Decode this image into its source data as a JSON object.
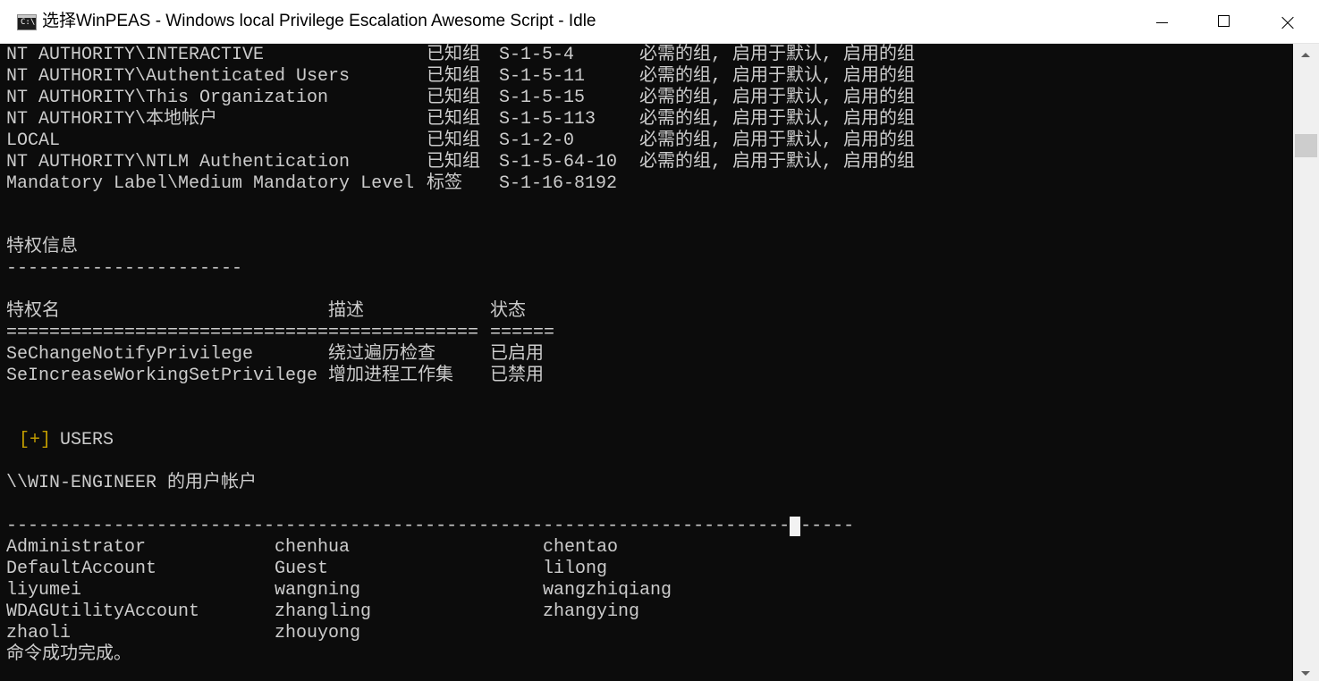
{
  "window": {
    "title": "选择WinPEAS - Windows local Privilege Escalation Awesome Script - Idle",
    "icon": "cmd-console-icon",
    "icon_text": "C:\\"
  },
  "groups": [
    {
      "name": "NT AUTHORITY\\INTERACTIVE",
      "type": "已知组",
      "sid": "S-1-5-4",
      "attributes": "必需的组, 启用于默认, 启用的组"
    },
    {
      "name": "NT AUTHORITY\\Authenticated Users",
      "type": "已知组",
      "sid": "S-1-5-11",
      "attributes": "必需的组, 启用于默认, 启用的组"
    },
    {
      "name": "NT AUTHORITY\\This Organization",
      "type": "已知组",
      "sid": "S-1-5-15",
      "attributes": "必需的组, 启用于默认, 启用的组"
    },
    {
      "name": "NT AUTHORITY\\本地帐户",
      "type": "已知组",
      "sid": "S-1-5-113",
      "attributes": "必需的组, 启用于默认, 启用的组"
    },
    {
      "name": "LOCAL",
      "type": "已知组",
      "sid": "S-1-2-0",
      "attributes": "必需的组, 启用于默认, 启用的组"
    },
    {
      "name": "NT AUTHORITY\\NTLM Authentication",
      "type": "已知组",
      "sid": "S-1-5-64-10",
      "attributes": "必需的组, 启用于默认, 启用的组"
    },
    {
      "name": "Mandatory Label\\Medium Mandatory Level",
      "type": "标签",
      "sid": "S-1-16-8192",
      "attributes": ""
    }
  ],
  "privileges": {
    "section_title": "特权信息",
    "section_rule": "----------------------",
    "headers": {
      "name": "特权名",
      "description": "描述",
      "state": "状态"
    },
    "separators": {
      "name": "==============================",
      "description": "==============",
      "state": "======"
    },
    "rows": [
      {
        "name": "SeChangeNotifyPrivilege",
        "description": "绕过遍历检查",
        "state": "已启用"
      },
      {
        "name": "SeIncreaseWorkingSetPrivilege",
        "description": "增加进程工作集",
        "state": "已禁用"
      }
    ]
  },
  "users_section": {
    "marker": "[+]",
    "title": "USERS",
    "accounts_heading": "\\\\WIN-ENGINEER 的用户帐户",
    "rule": "-------------------------------------------------------------------------------",
    "accounts": [
      [
        "Administrator",
        "chenhua",
        "chentao"
      ],
      [
        "DefaultAccount",
        "Guest",
        "lilong"
      ],
      [
        "liyumei",
        "wangning",
        "wangzhiqiang"
      ],
      [
        "WDAGUtilityAccount",
        "zhangling",
        "zhangying"
      ],
      [
        "zhaoli",
        "zhouyong",
        ""
      ]
    ],
    "completion": "命令成功完成。"
  },
  "colors": {
    "console_bg": "#0c0c0c",
    "console_fg": "#cccccc",
    "marker": "#c19c00"
  }
}
